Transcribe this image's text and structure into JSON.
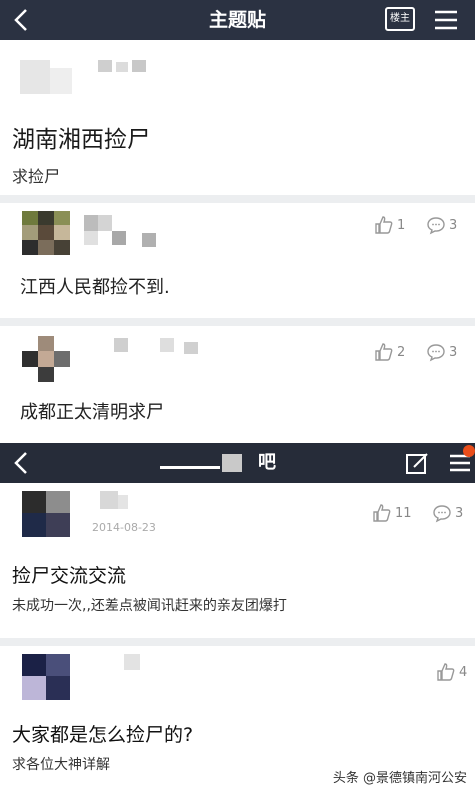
{
  "top_nav": {
    "title": "主题贴",
    "owner_button": "楼主"
  },
  "thread": {
    "title": "湖南湘西捡尸",
    "subtitle": "求捡尸"
  },
  "replies": [
    {
      "text": "江西人民都捡不到.",
      "likes": "1",
      "comments": "3"
    },
    {
      "text": "成都正太清明求尸",
      "likes": "2",
      "comments": "3"
    }
  ],
  "second_nav": {
    "title": "吧"
  },
  "posts": [
    {
      "date": "2014-08-23",
      "likes": "11",
      "comments": "3",
      "title": "捡尸交流交流",
      "body": "未成功一次,,还差点被闻讯赶来的亲友团爆打"
    },
    {
      "likes": "4",
      "title": "大家都是怎么捡尸的?",
      "body": "求各位大神详解"
    }
  ],
  "watermark": "头条 @景德镇南河公安"
}
